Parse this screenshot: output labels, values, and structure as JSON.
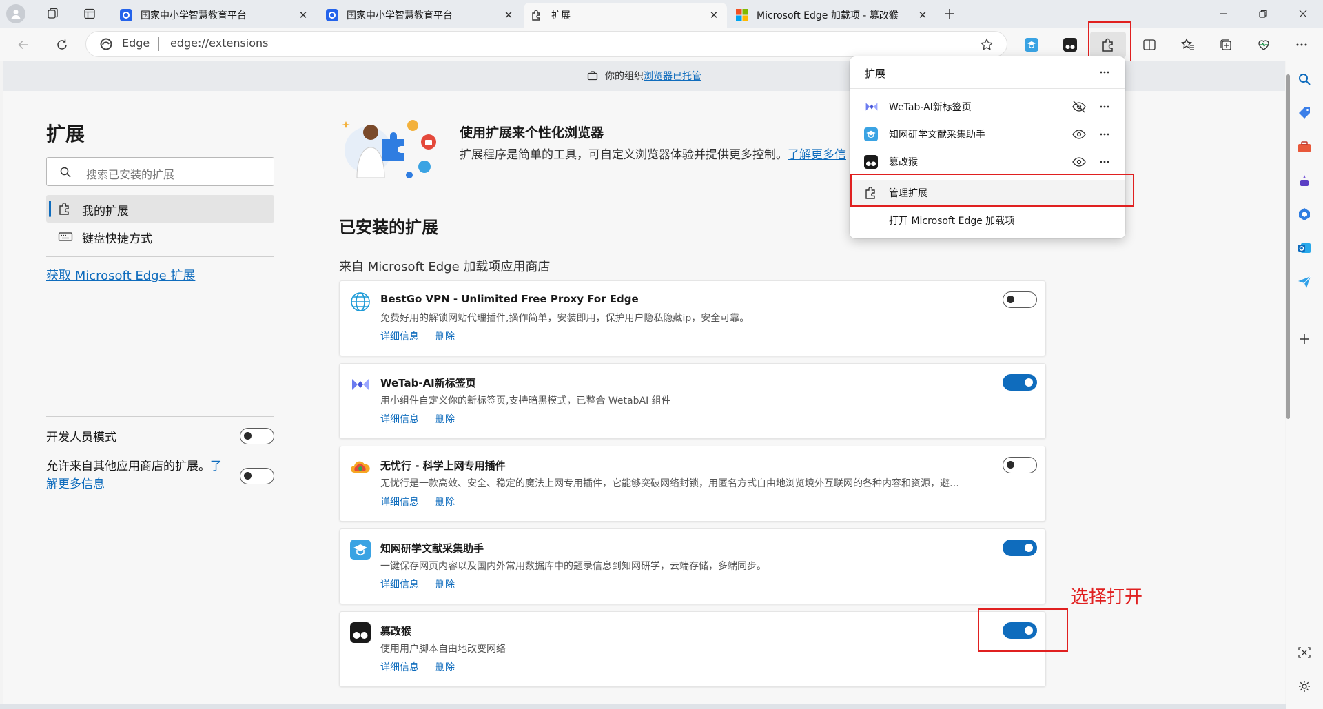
{
  "tabs": [
    {
      "label": "国家中小学智慧教育平台",
      "active": false
    },
    {
      "label": "国家中小学智慧教育平台",
      "active": false
    },
    {
      "label": "扩展",
      "active": true
    },
    {
      "label": "Microsoft Edge 加载项 - 篡改猴",
      "active": false
    }
  ],
  "address": {
    "brand": "Edge",
    "url": "edge://extensions"
  },
  "banner": {
    "prefix": "你的组织",
    "link": "浏览器已托管"
  },
  "sidebar": {
    "title": "扩展",
    "search_placeholder": "搜索已安装的扩展",
    "nav": [
      {
        "label": "我的扩展",
        "selected": true
      },
      {
        "label": "键盘快捷方式",
        "selected": false
      }
    ],
    "get_link": "获取 Microsoft Edge 扩展",
    "dev_mode": "开发人员模式",
    "allow_other_text": "允许来自其他应用商店的扩展。",
    "allow_other_link1": "了",
    "allow_other_link2": "解更多信息"
  },
  "main": {
    "intro_title": "使用扩展来个性化浏览器",
    "intro_text": "扩展程序是简单的工具，可自定义浏览器体验并提供更多控制。",
    "intro_link": "了解更多信",
    "installed_title": "已安装的扩展",
    "store_label": "来自 Microsoft Edge 加载项应用商店",
    "details_label": "详细信息",
    "remove_label": "删除",
    "extensions": [
      {
        "name": "BestGo VPN - Unlimited Free Proxy For Edge",
        "description": "免费好用的解锁网站代理插件,操作简单，安装即用，保护用户隐私隐藏ip，安全可靠。",
        "enabled": false,
        "icon": "globe-icon"
      },
      {
        "name": "WeTab-AI新标签页",
        "description": "用小组件自定义你的新标签页,支持暗黑模式，已整合 WetabAI 组件",
        "enabled": true,
        "icon": "wetab-icon"
      },
      {
        "name": "无忧行 - 科学上网专用插件",
        "description": "无忧行是一款高效、安全、稳定的魔法上网专用插件，它能够突破网络封锁，用匿名方式自由地浏览境外互联网的各种内容和资源，避…",
        "enabled": false,
        "icon": "cloud-icon"
      },
      {
        "name": "知网研学文献采集助手",
        "description": "一键保存网页内容以及国内外常用数据库中的题录信息到知网研学，云端存储，多端同步。",
        "enabled": true,
        "icon": "cnki-icon"
      },
      {
        "name": "篡改猴",
        "description": "使用用户脚本自由地改变网络",
        "enabled": true,
        "icon": "tampermonkey-icon"
      }
    ]
  },
  "popup": {
    "title": "扩展",
    "items": [
      {
        "label": "WeTab-AI新标签页",
        "visibility": "hidden"
      },
      {
        "label": "知网研学文献采集助手",
        "visibility": "shown"
      },
      {
        "label": "篡改猴",
        "visibility": "shown"
      }
    ],
    "manage_label": "管理扩展",
    "open_store_label": "打开 Microsoft Edge 加载项"
  },
  "annotation": {
    "text": "选择打开",
    "color": "#e02020"
  },
  "colors": {
    "accent": "#0f6cbd",
    "highlight": "#e02020"
  }
}
